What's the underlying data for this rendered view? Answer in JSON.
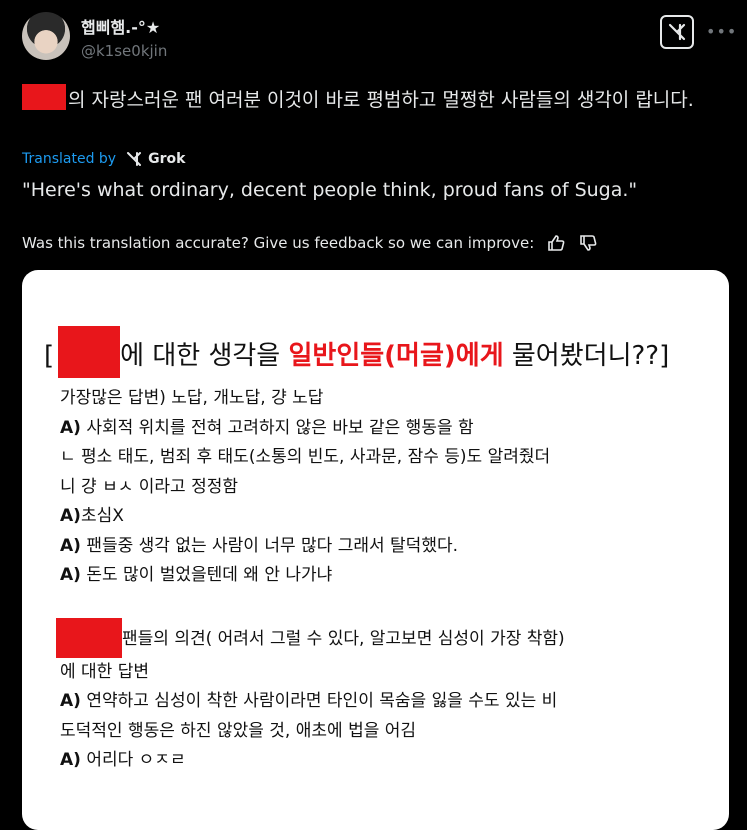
{
  "author": {
    "display_name": "햅삐햄.-°★",
    "handle": "@k1se0kjin"
  },
  "header": {
    "grok_icon": "grok-logo-icon",
    "more_icon": "more-icon"
  },
  "post": {
    "text": "의 자랑스러운 팬 여러분 이것이 바로 평범하고 멀쩡한 사람들의 생각이 랍니다.",
    "redacted_color": "#e8161b"
  },
  "translation": {
    "label": "Translated by",
    "engine": "Grok",
    "text": "\"Here's what ordinary, decent people think, proud fans of Suga.\"",
    "feedback_prompt": "Was this translation accurate? Give us feedback so we can improve:"
  },
  "image": {
    "title_prefix": "[",
    "title_part1": "에 대한 생각을 ",
    "title_highlight": "일반인들(머글)에게",
    "title_part2": " 물어봤더니??]",
    "lines": [
      {
        "a": "",
        "t": "가장많은 답변) 노답, 개노답, 걍 노답"
      },
      {
        "a": "A)",
        "t": " 사회적 위치를 전혀 고려하지 않은 바보 같은 행동을 함"
      },
      {
        "a": "",
        "t": "ㄴ 평소 태도, 범죄 후 태도(소통의 빈도, 사과문, 잠수 등)도 알려줬더"
      },
      {
        "a": "",
        "t": "니 걍 ㅂㅅ 이라고 정정함"
      },
      {
        "a": "A)",
        "t": "초심X"
      },
      {
        "a": "A)",
        "t": " 팬들중 생각 없는 사람이 너무 많다 그래서 탈덕했다."
      },
      {
        "a": "A)",
        "t": " 돈도 많이 벌었을텐데 왜 안 나가냐"
      }
    ],
    "section2_title": "팬들의 의견( 어려서 그럴 수 있다, 알고보면 심성이 가장 착함)",
    "section2_title_cont": "에 대한 답변",
    "lines2": [
      {
        "a": "A)",
        "t": " 연약하고 심성이 착한 사람이라면 타인이 목숨을 잃을 수도 있는 비"
      },
      {
        "a": "",
        "t": "도덕적인 행동은 하진 않았을 것, 애초에 법을 어김"
      },
      {
        "a": "A)",
        "t": " 어리다 ㅇㅈㄹ"
      }
    ]
  }
}
